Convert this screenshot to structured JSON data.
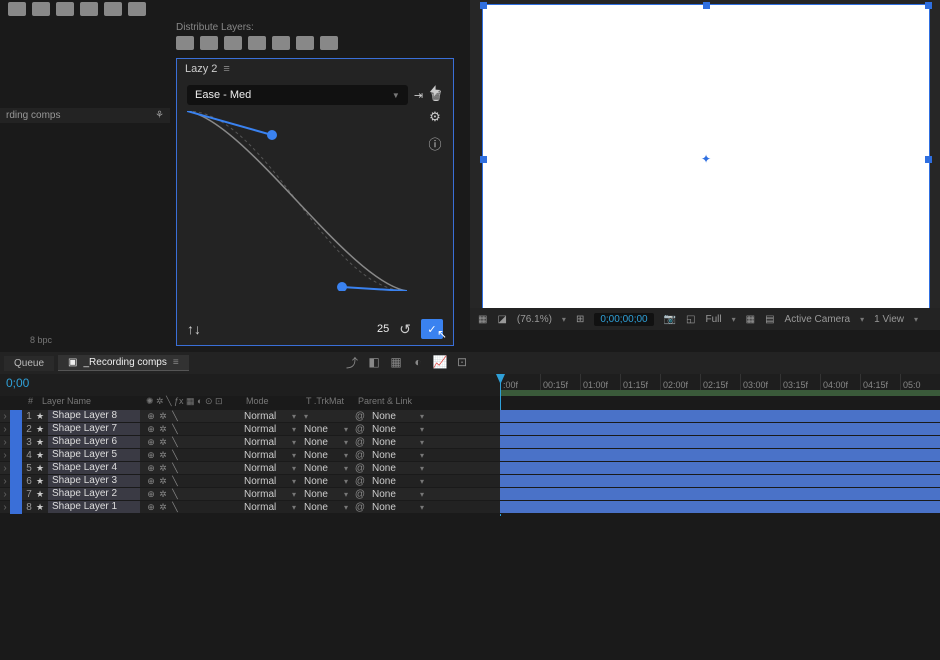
{
  "toolbar": {
    "distribute_label": "Distribute Layers:"
  },
  "left_panel": {
    "item": "rding comps",
    "flow_icon": "⚘"
  },
  "lazy": {
    "title": "Lazy 2",
    "preset": "Ease - Med",
    "value": "25",
    "swap_icon": "↑↓",
    "reset_icon": "↺",
    "apply_icon": "✓",
    "bolt_icon": "⚡",
    "import_icon": "⇥",
    "trash_icon": "🗑",
    "gear_icon": "⚙",
    "info_icon": "ⓘ"
  },
  "viewer": {
    "zoom": "(76.1%)",
    "timecode": "0;00;00;00",
    "resolution": "Full",
    "camera": "Active Camera",
    "views": "1 View"
  },
  "project": {
    "bpc": "8 bpc"
  },
  "tabs": {
    "queue": "Queue",
    "active": "_Recording comps"
  },
  "timeline": {
    "timecode": "0;00",
    "ruler": [
      ":00f",
      "00:15f",
      "01:00f",
      "01:15f",
      "02:00f",
      "02:15f",
      "03:00f",
      "03:15f",
      "04:00f",
      "04:15f",
      "05:0"
    ],
    "columns": {
      "num": "#",
      "name": "Layer Name",
      "mode": "Mode",
      "trk": "T .TrkMat",
      "parent": "Parent & Link"
    }
  },
  "layers": [
    {
      "num": "1",
      "name": "Shape Layer 8",
      "mode": "Normal",
      "trk": "",
      "parent": "None"
    },
    {
      "num": "2",
      "name": "Shape Layer 7",
      "mode": "Normal",
      "trk": "None",
      "parent": "None"
    },
    {
      "num": "3",
      "name": "Shape Layer 6",
      "mode": "Normal",
      "trk": "None",
      "parent": "None"
    },
    {
      "num": "4",
      "name": "Shape Layer 5",
      "mode": "Normal",
      "trk": "None",
      "parent": "None"
    },
    {
      "num": "5",
      "name": "Shape Layer 4",
      "mode": "Normal",
      "trk": "None",
      "parent": "None"
    },
    {
      "num": "6",
      "name": "Shape Layer 3",
      "mode": "Normal",
      "trk": "None",
      "parent": "None"
    },
    {
      "num": "7",
      "name": "Shape Layer 2",
      "mode": "Normal",
      "trk": "None",
      "parent": "None"
    },
    {
      "num": "8",
      "name": "Shape Layer 1",
      "mode": "Normal",
      "trk": "None",
      "parent": "None"
    }
  ]
}
